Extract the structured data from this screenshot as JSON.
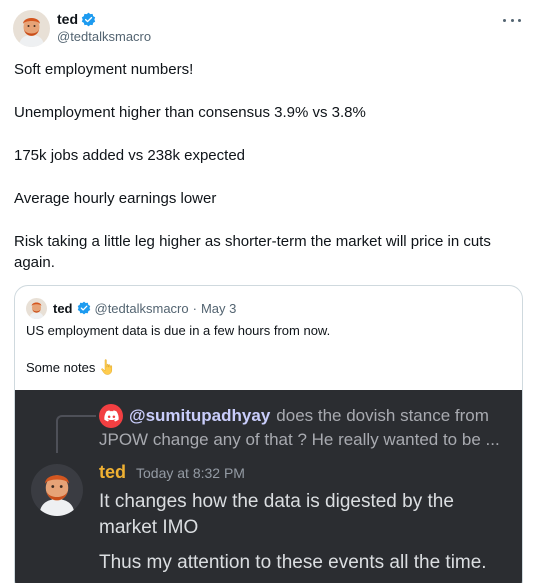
{
  "tweet": {
    "author_name": "ted",
    "author_handle": "@tedtalksmacro",
    "more_icon": "more-dots-icon",
    "lines": [
      "Soft employment numbers!",
      "Unemployment higher than consensus 3.9% vs 3.8%",
      "175k jobs added vs 238k expected",
      "Average hourly earnings lower",
      "Risk taking a little leg higher as shorter-term the market will price in cuts again."
    ]
  },
  "quote": {
    "author_name": "ted",
    "author_handle": "@tedtalksmacro",
    "separator": "·",
    "date": "May 3",
    "text1": "US employment data is due in a few hours from now.",
    "text2": "Some notes",
    "emoji_icon": "pointing-down-icon"
  },
  "discord": {
    "reply_mention": "@sumitupadhyay",
    "reply_text": "does the dovish stance from",
    "reply_text_cont": "JPOW change any of that ? He really wanted to be ...",
    "name": "ted",
    "time": "Today at 8:32 PM",
    "message_lines": [
      "It changes how the data is digested by the",
      "market IMO",
      "Thus my attention to these events all the time."
    ]
  },
  "colors": {
    "verified": "#1d9bf0",
    "discord_bg": "#2b2d31",
    "discord_name": "#f0b132",
    "mention": "#c9cdfb"
  }
}
